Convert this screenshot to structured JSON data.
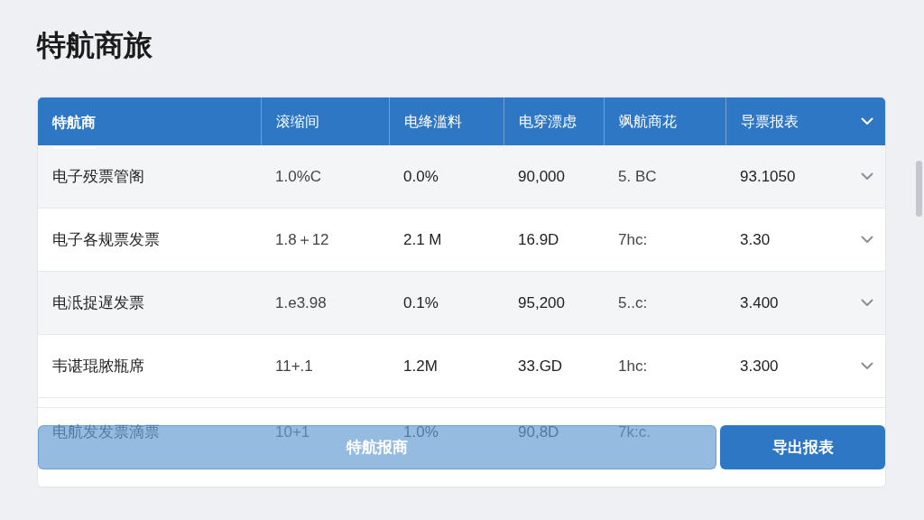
{
  "title": "特航商旅",
  "table": {
    "columns": [
      {
        "label": "特航商",
        "selected": true
      },
      {
        "label": "滚缩间",
        "selected": false
      },
      {
        "label": "电绛滥料",
        "selected": false
      },
      {
        "label": "电穿漂虑",
        "selected": false
      },
      {
        "label": "飒航商花",
        "selected": false
      },
      {
        "label": "导票报表",
        "selected": false
      }
    ],
    "rows": [
      {
        "kind": "full",
        "cells": [
          "电子殁票管阁",
          "1.0%C",
          "0.0%",
          "90,000",
          "5. BC",
          "93.1050"
        ]
      },
      {
        "kind": "full",
        "cells": [
          "电子各规票发票",
          "1.8＋12",
          "2.1 M",
          "16.9D",
          "7hc:",
          "3.30"
        ]
      },
      {
        "kind": "full",
        "cells": [
          "电泜捉遅发票",
          "1.e3.98",
          "0.1%",
          "95,200",
          "5..c:",
          "3.400"
        ]
      },
      {
        "kind": "full",
        "cells": [
          "韦谌琨脓瓶席",
          "11+.1",
          "1.2M",
          "33.GD",
          "1hc:",
          "3.300"
        ]
      },
      {
        "kind": "behind_buttons",
        "cells": [
          "电航发发票滴票",
          "10+1",
          "1.0%",
          "90,8D",
          "7k:c."
        ]
      }
    ]
  },
  "buttons": [
    {
      "label": "特航报商",
      "kind": "translucent"
    },
    {
      "label": "导出报表",
      "kind": "solid"
    }
  ]
}
